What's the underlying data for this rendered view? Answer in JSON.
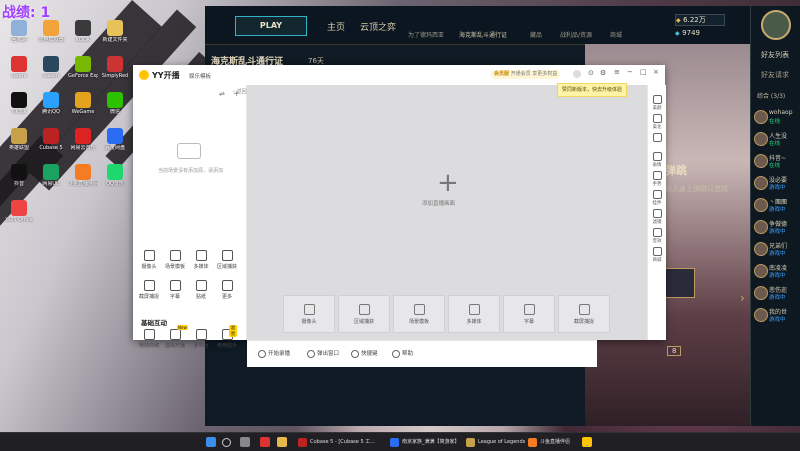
{
  "overlay": {
    "record_label": "战绩:",
    "record_value": "1"
  },
  "desktop_icons": [
    {
      "label": "回收站",
      "color": "#8fb0d8"
    },
    {
      "label": "雷电模拟器",
      "color": "#f2a33a"
    },
    {
      "label": "KOOK",
      "color": "#3a3a3a"
    },
    {
      "label": "新建文件夹",
      "color": "#e7c15a"
    },
    {
      "label": "Opera",
      "color": "#d33"
    },
    {
      "label": "Steam",
      "color": "#2a475e"
    },
    {
      "label": "GeForce Experience",
      "color": "#76b900"
    },
    {
      "label": "SimplyRed",
      "color": "#c33"
    },
    {
      "label": "TikTok",
      "color": "#111"
    },
    {
      "label": "腾讯QQ",
      "color": "#2aa1ff"
    },
    {
      "label": "WeGame",
      "color": "#e4a31f"
    },
    {
      "label": "微信",
      "color": "#2dc100"
    },
    {
      "label": "英雄联盟",
      "color": "#c9a04a"
    },
    {
      "label": "Cubase 5",
      "color": "#b22"
    },
    {
      "label": "网易云音乐",
      "color": "#d22"
    },
    {
      "label": "百度网盘",
      "color": "#2a6df4"
    },
    {
      "label": "抖音",
      "color": "#111"
    },
    {
      "label": "网易UU",
      "color": "#1aa260"
    },
    {
      "label": "斗鱼直播伴侣",
      "color": "#f57c22"
    },
    {
      "label": "QQ音乐",
      "color": "#1ed76f"
    },
    {
      "label": "WPS Office",
      "color": "#e44"
    }
  ],
  "lol": {
    "play_label": "PLAY",
    "tabs": [
      "主页",
      "云顶之弈"
    ],
    "sub_tabs": [
      "为了德玛西亚",
      "海克斯乱斗通行证",
      "藏品",
      "战利品/资源",
      "商城"
    ],
    "pass_title": "海克斯乱斗通行证",
    "days_left": "76天",
    "currency_rp": "6.22万",
    "currency_be": "9749",
    "page_heading": "弹跳",
    "page_desc": "敌人身上弹跳以造成",
    "carousel_badge": "8",
    "friends": {
      "header": "好友列表",
      "request": "好友请求",
      "group": "综合 (3/3)",
      "list": [
        {
          "name": "wohaop",
          "status": "在线",
          "color": "#29d17a"
        },
        {
          "name": "人生没",
          "status": "在线",
          "color": "#29d17a"
        },
        {
          "name": "抖音~",
          "status": "在线",
          "color": "#29d17a"
        },
        {
          "name": "没必要",
          "status": "游戏中",
          "color": "#3fa1ff"
        },
        {
          "name": "丶團團",
          "status": "游戏中",
          "color": "#3fa1ff"
        },
        {
          "name": "争做德",
          "status": "游戏中",
          "color": "#3fa1ff"
        },
        {
          "name": "兄弟们",
          "status": "游戏中",
          "color": "#3fa1ff"
        },
        {
          "name": "南凌凌",
          "status": "游戏中",
          "color": "#3fa1ff"
        },
        {
          "name": "悲伤迩",
          "status": "游戏中",
          "color": "#3fa1ff"
        },
        {
          "name": "我的世",
          "status": "游戏中",
          "color": "#3fa1ff"
        }
      ]
    }
  },
  "yy": {
    "logo": "YY开播",
    "mode": "娱乐模板",
    "vip_label": "会员服",
    "vip_desc": "开通会员 享更多权益",
    "tooltip": "赞同新版本，快去升级体验",
    "back_label": "‹ 返回",
    "empty_hint": "当前场景没有添加源，请添加",
    "add_source": "添加直播画面",
    "tools": [
      "摄像头",
      "场景模板",
      "多媒体",
      "区域捕获",
      "截屏捕捉",
      "字幕",
      "贴纸",
      "更多"
    ],
    "section_title": "基础互动",
    "interact": [
      {
        "label": "特效商城",
        "tag": ""
      },
      {
        "label": "虚拟开播",
        "tag": "New"
      },
      {
        "label": "多平台",
        "tag": ""
      },
      {
        "label": "电竞助手",
        "tag": "超赞"
      }
    ],
    "cards": [
      "摄像头",
      "区域捕获",
      "场景模板",
      "多媒体",
      "字幕",
      "截屏捕捉"
    ],
    "right_actions": [
      "美颜",
      "美化",
      "",
      "表情",
      "手势",
      "挂件",
      "滤镜",
      "音效",
      "商城"
    ],
    "bottom": [
      "开始录播",
      "弹出窗口",
      "快捷键",
      "帮助"
    ]
  },
  "taskbar": {
    "apps": [
      {
        "label": "Cubase 5 - [Cubase 5 工...",
        "color": "#b22"
      },
      {
        "label": "南京家族_满满【简游家】",
        "color": "#2a6df4"
      },
      {
        "label": "League of Legends",
        "color": "#c9a04a"
      },
      {
        "label": "斗鱼直播伴侣",
        "color": "#f57c22"
      }
    ]
  }
}
